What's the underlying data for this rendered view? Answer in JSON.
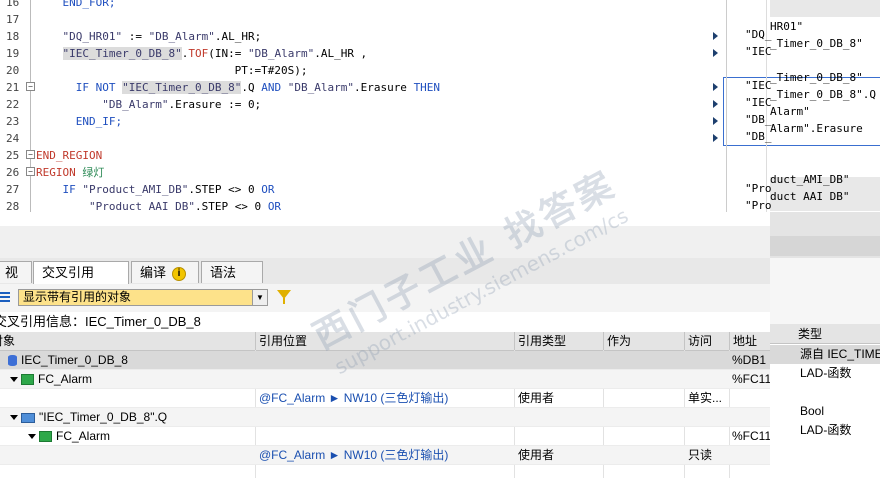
{
  "editor": {
    "lines": [
      {
        "n": "16",
        "html": "    <span class=\"kw\">END_FOR;</span>"
      },
      {
        "n": "17",
        "html": ""
      },
      {
        "n": "18",
        "html": "    <span class=\"str\">\"DQ_HR01\"</span> := <span class=\"str\">\"DB_Alarm\"</span>.AL_HR;"
      },
      {
        "n": "19",
        "html": "    <span class=\"hl\"><span class=\"str\">\"IEC_Timer_0_DB_8\"</span></span>.<span class=\"red\">TOF</span>(IN:= <span class=\"str\">\"DB_Alarm\"</span>.AL_HR ,"
      },
      {
        "n": "20",
        "html": "                              PT:=T#20S);"
      },
      {
        "n": "21",
        "html": "      <span class=\"kw\">IF NOT</span> <span class=\"hl\"><span class=\"str\">\"IEC_Timer_0_DB_8\"</span></span>.Q <span class=\"kw\">AND</span> <span class=\"str\">\"DB_Alarm\"</span>.Erasure <span class=\"kw\">THEN</span>"
      },
      {
        "n": "22",
        "html": "          <span class=\"str\">\"DB_Alarm\"</span>.Erasure := 0;"
      },
      {
        "n": "23",
        "html": "      <span class=\"kw\">END_IF;</span>"
      },
      {
        "n": "24",
        "html": ""
      },
      {
        "n": "25",
        "html": "<span class=\"red\">END_REGION</span>"
      },
      {
        "n": "26",
        "html": "<span class=\"red\">REGION</span> <span class=\"grn\">绿灯</span>"
      },
      {
        "n": "27",
        "html": "    <span class=\"kw\">IF</span> <span class=\"str\">\"Product_AMI_DB\"</span>.STEP &lt;&gt; 0 <span class=\"kw\">OR</span>"
      },
      {
        "n": "28",
        "html": "        <span class=\"str\">\"Product AAI DB\"</span>.STEP &lt;&gt; 0 <span class=\"kw\">OR</span>"
      }
    ]
  },
  "param_pane": {
    "col1": [
      "\"DQ_",
      "\"IEC",
      "\"IEC",
      "\"IEC",
      "\"DB_",
      "\"DB_",
      "\"Pro",
      "\"Pro"
    ],
    "col2": [
      "HR01\"",
      "_Timer_0_DB_8\"",
      "_Timer_0_DB_8\"",
      "_Timer_0_DB_8\".Q",
      "Alarm\"",
      "Alarm\".Erasure",
      "duct_AMI_DB\"",
      "duct AAI DB\""
    ]
  },
  "tabs": [
    {
      "label": "视"
    },
    {
      "label": "交叉引用"
    },
    {
      "label": "编译"
    },
    {
      "label": "语法"
    }
  ],
  "filter": {
    "value": "显示带有引用的对象"
  },
  "info_title": "交叉引用信息：IEC_Timer_0_DB_8",
  "table": {
    "headers": [
      "对象",
      "引用位置",
      "引用类型",
      "作为",
      "访问",
      "地址"
    ],
    "rows": [
      {
        "object": "IEC_Timer_0_DB_8",
        "location": "",
        "reftype": "",
        "as": "",
        "access": "",
        "address": "%DB1",
        "type": "源自 IEC_TIMER"
      },
      {
        "object": "FC_Alarm",
        "location": "",
        "reftype": "",
        "as": "",
        "access": "",
        "address": "%FC11",
        "type": "LAD-函数"
      },
      {
        "object": "",
        "location": "@FC_Alarm ► NW10 (三色灯输出)",
        "reftype": "使用者",
        "as": "",
        "access": "单实...",
        "address": "",
        "type": ""
      },
      {
        "object": "\"IEC_Timer_0_DB_8\".Q",
        "location": "",
        "reftype": "",
        "as": "",
        "access": "",
        "address": "",
        "type": "Bool"
      },
      {
        "object": "FC_Alarm",
        "location": "",
        "reftype": "",
        "as": "",
        "access": "",
        "address": "%FC11",
        "type": "LAD-函数"
      },
      {
        "object": "",
        "location": "@FC_Alarm ► NW10 (三色灯输出)",
        "reftype": "使用者",
        "as": "",
        "access": "只读",
        "address": "",
        "type": ""
      }
    ]
  },
  "type_pane": {
    "header": "类型"
  },
  "watermark": {
    "line1": "西门子工业 找答案",
    "line2": "support.industry.siemens.com/cs"
  }
}
